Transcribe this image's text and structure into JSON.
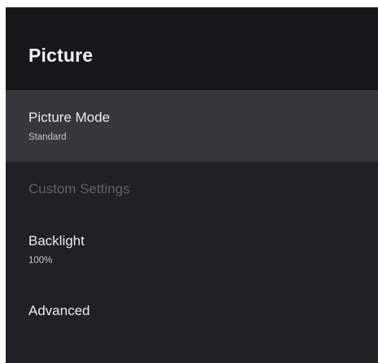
{
  "header": {
    "title": "Picture"
  },
  "menu": {
    "items": [
      {
        "label": "Picture Mode",
        "value": "Standard",
        "selected": true,
        "enabled": true
      },
      {
        "label": "Custom Settings",
        "enabled": false
      },
      {
        "label": "Backlight",
        "value": "100%",
        "enabled": true
      },
      {
        "label": "Advanced",
        "enabled": true
      }
    ]
  },
  "colors": {
    "panel_background": "#202124",
    "header_background": "#17181a",
    "selected_background": "#36373a",
    "disabled_text": "#5f6166"
  }
}
